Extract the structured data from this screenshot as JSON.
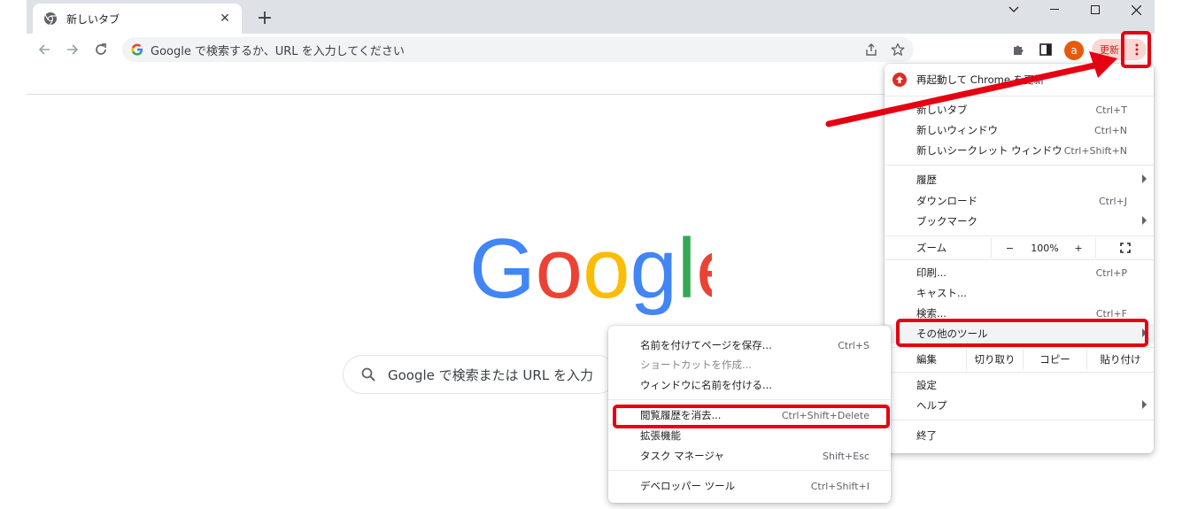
{
  "tab": {
    "title": "新しいタブ",
    "close_glyph": "✕"
  },
  "window": {
    "new_tab_glyph": "+"
  },
  "omnibox": {
    "placeholder": "Google で検索するか、URL を入力してください"
  },
  "profile": {
    "avatar_letter": "a"
  },
  "update_button": {
    "label": "更新"
  },
  "search": {
    "placeholder": "Google で検索または URL を入力"
  },
  "menu": {
    "update_item": "再起動して Chrome を更新",
    "items": [
      {
        "label": "新しいタブ",
        "shortcut": "Ctrl+T"
      },
      {
        "label": "新しいウィンドウ",
        "shortcut": "Ctrl+N"
      },
      {
        "label": "新しいシークレット ウィンドウ",
        "shortcut": "Ctrl+Shift+N"
      },
      {
        "label": "履歴",
        "shortcut": ""
      },
      {
        "label": "ダウンロード",
        "shortcut": "Ctrl+J"
      },
      {
        "label": "ブックマーク",
        "shortcut": ""
      },
      {
        "label": "印刷...",
        "shortcut": "Ctrl+P"
      },
      {
        "label": "キャスト...",
        "shortcut": ""
      },
      {
        "label": "検索...",
        "shortcut": "Ctrl+F"
      },
      {
        "label": "その他のツール",
        "shortcut": ""
      },
      {
        "label": "設定",
        "shortcut": ""
      },
      {
        "label": "ヘルプ",
        "shortcut": ""
      },
      {
        "label": "終了",
        "shortcut": ""
      }
    ],
    "zoom": {
      "label": "ズーム",
      "minus": "−",
      "value": "100%",
      "plus": "+"
    },
    "edit": {
      "label": "編集",
      "cut": "切り取り",
      "copy": "コピー",
      "paste": "貼り付け"
    }
  },
  "submenu": {
    "items": [
      {
        "label": "名前を付けてページを保存...",
        "shortcut": "Ctrl+S"
      },
      {
        "label": "ショートカットを作成...",
        "shortcut": ""
      },
      {
        "label": "ウィンドウに名前を付ける...",
        "shortcut": ""
      },
      {
        "label": "閲覧履歴を消去...",
        "shortcut": "Ctrl+Shift+Delete"
      },
      {
        "label": "拡張機能",
        "shortcut": ""
      },
      {
        "label": "タスク マネージャ",
        "shortcut": "Shift+Esc"
      },
      {
        "label": "デベロッパー ツール",
        "shortcut": "Ctrl+Shift+I"
      }
    ]
  },
  "colors": {
    "highlight": "#e60012",
    "update_bg": "#f8d7d4",
    "update_text": "#c5221f",
    "avatar_bg": "#e8590c",
    "google_blue": "#4285F4",
    "google_red": "#EA4335",
    "google_yellow": "#FBBC05",
    "google_green": "#34A853"
  },
  "icons": [
    "chrome-icon",
    "close-icon",
    "plus-icon",
    "back-icon",
    "forward-icon",
    "reload-icon",
    "google-g-icon",
    "share-icon",
    "star-icon",
    "extensions-icon",
    "side-panel-icon",
    "kebab-icon",
    "update-icon",
    "fullscreen-icon",
    "search-icon",
    "chevron-right-icon"
  ]
}
